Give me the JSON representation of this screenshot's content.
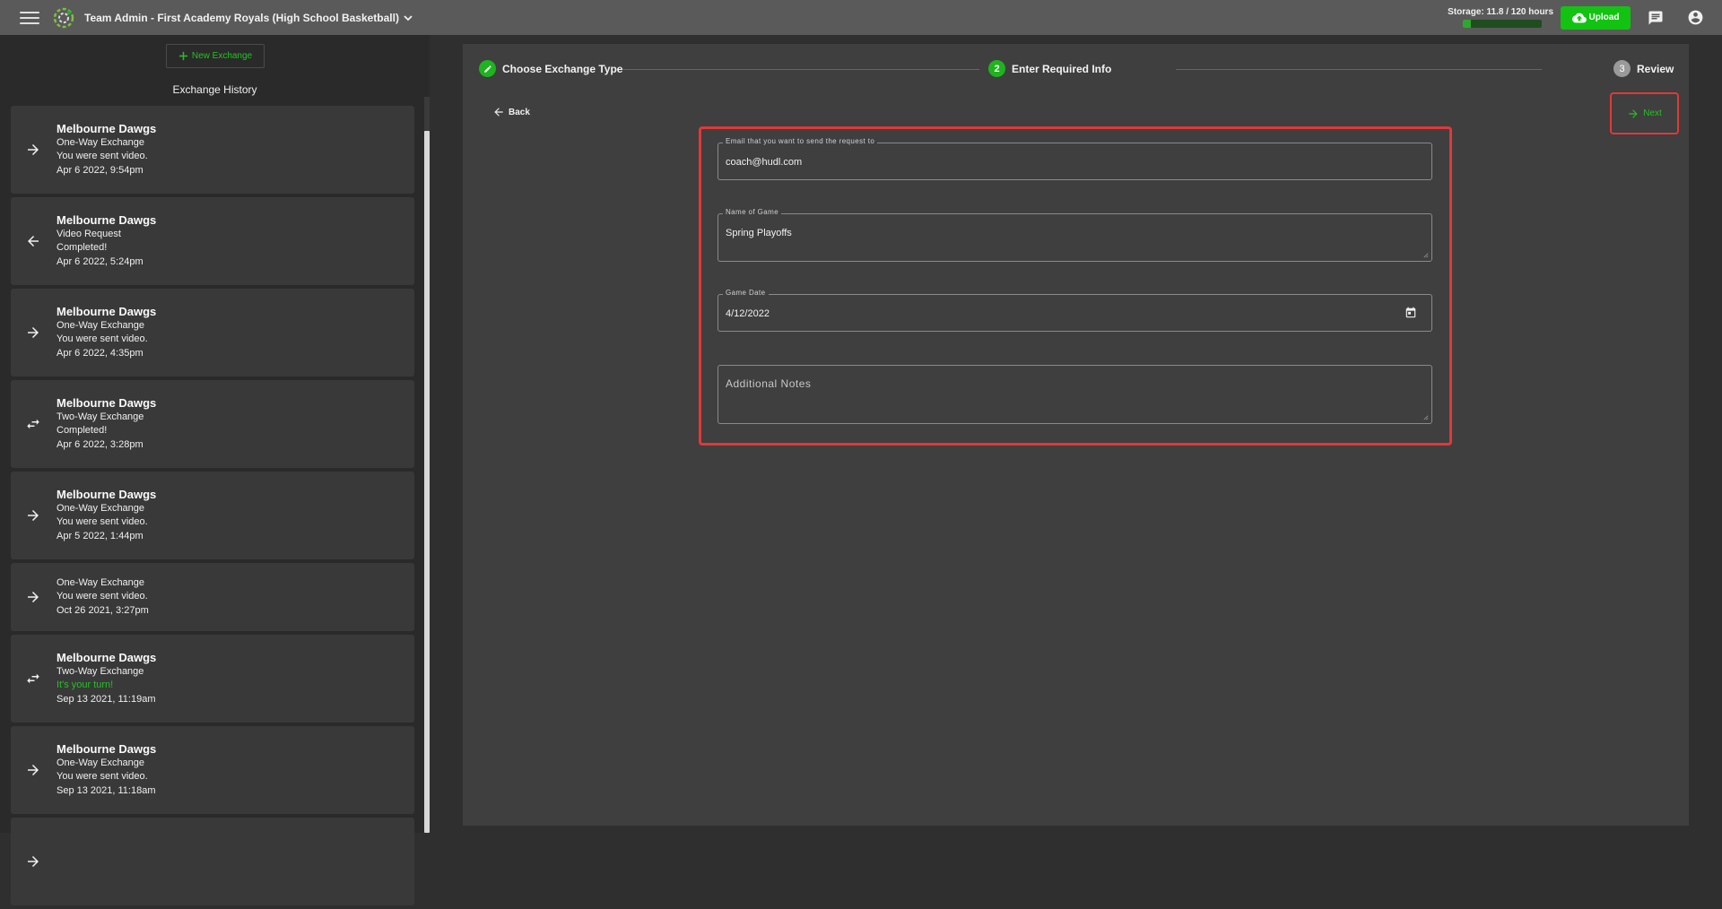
{
  "header": {
    "team_title": "Team Admin - First Academy Royals (High School Basketball)",
    "storage_label": "Storage: 11.8 / 120 hours",
    "storage_fraction": 0.098,
    "upload_label": "Upload"
  },
  "sidebar": {
    "new_exchange_label": "New Exchange",
    "history_title": "Exchange History",
    "items": [
      {
        "icon": "arrow-right-icon",
        "team": "Melbourne Dawgs",
        "type": "One-Way Exchange",
        "status": "You were sent video.",
        "status_green": false,
        "date": "Apr 6 2022, 9:54pm"
      },
      {
        "icon": "arrow-left-icon",
        "team": "Melbourne Dawgs",
        "type": "Video Request",
        "status": "Completed!",
        "status_green": false,
        "date": "Apr 6 2022, 5:24pm"
      },
      {
        "icon": "arrow-right-icon",
        "team": "Melbourne Dawgs",
        "type": "One-Way Exchange",
        "status": "You were sent video.",
        "status_green": false,
        "date": "Apr 6 2022, 4:35pm"
      },
      {
        "icon": "swap-icon",
        "team": "Melbourne Dawgs",
        "type": "Two-Way Exchange",
        "status": "Completed!",
        "status_green": false,
        "date": "Apr 6 2022, 3:28pm"
      },
      {
        "icon": "arrow-right-icon",
        "team": "Melbourne Dawgs",
        "type": "One-Way Exchange",
        "status": "You were sent video.",
        "status_green": false,
        "date": "Apr 5 2022, 1:44pm"
      },
      {
        "icon": "arrow-right-icon",
        "team": "",
        "type": "One-Way Exchange",
        "status": "You were sent video.",
        "status_green": false,
        "date": "Oct 26 2021, 3:27pm"
      },
      {
        "icon": "swap-icon",
        "team": "Melbourne Dawgs",
        "type": "Two-Way Exchange",
        "status": "It's your turn!",
        "status_green": true,
        "date": "Sep 13 2021, 11:19am"
      },
      {
        "icon": "arrow-right-icon",
        "team": "Melbourne Dawgs",
        "type": "One-Way Exchange",
        "status": "You were sent video.",
        "status_green": false,
        "date": "Sep 13 2021, 11:18am"
      },
      {
        "icon": "arrow-right-icon",
        "team": "",
        "type": "",
        "status": "",
        "status_green": false,
        "date": ""
      }
    ]
  },
  "stepper": {
    "steps": [
      {
        "number": "",
        "label": "Choose Exchange Type",
        "state": "done"
      },
      {
        "number": "2",
        "label": "Enter Required Info",
        "state": "active"
      },
      {
        "number": "3",
        "label": "Review",
        "state": "todo"
      }
    ]
  },
  "nav": {
    "back_label": "Back",
    "next_label": "Next"
  },
  "form": {
    "email_label": "Email that you want to send the request to",
    "email_value": "coach@hudl.com",
    "game_name_label": "Name of Game",
    "game_name_value": "Spring Playoffs",
    "game_date_label": "Game Date",
    "game_date_value": "4/12/2022",
    "notes_placeholder": "Additional Notes"
  },
  "colors": {
    "accent_green": "#22c322",
    "highlight_red": "#e0393a"
  }
}
